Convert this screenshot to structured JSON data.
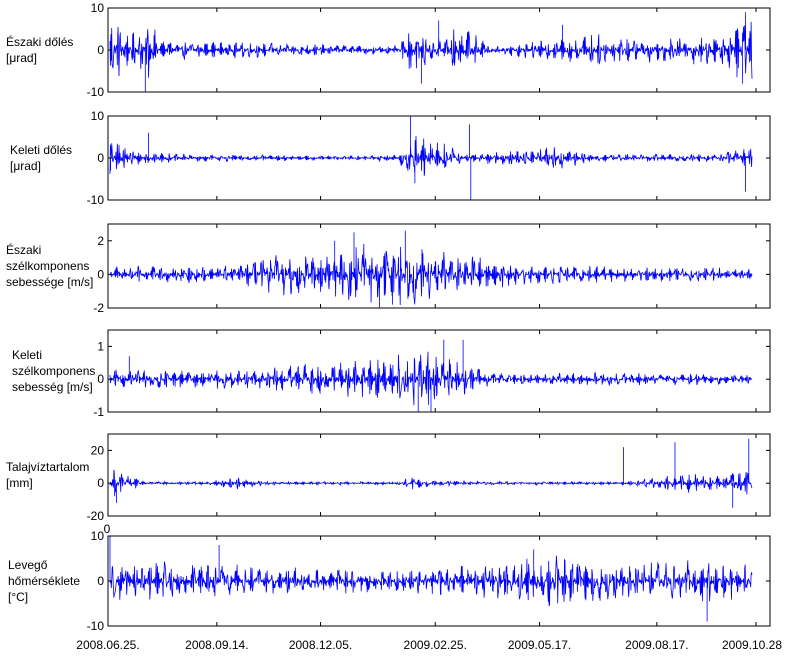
{
  "chart_data": {
    "type": "line",
    "x_tick_labels": [
      "2008.06.25.",
      "2008.09.14.",
      "2008.12.05.",
      "2009.02.25.",
      "2009.05.17.",
      "2009.08.17.",
      "2009.10.28"
    ],
    "panels": [
      {
        "ylabel": [
          "Északi dőlés",
          "[μrad]"
        ],
        "ylim": [
          -10,
          10
        ],
        "yticks": [
          -10,
          0,
          10
        ],
        "series": {
          "color": "#0000ff",
          "envelope": [
            [
              0,
              9
            ],
            [
              0.04,
              4
            ],
            [
              0.06,
              8
            ],
            [
              0.08,
              2.5
            ],
            [
              0.3,
              1.5
            ],
            [
              0.45,
              1
            ],
            [
              0.47,
              6
            ],
            [
              0.5,
              3
            ],
            [
              0.55,
              6
            ],
            [
              0.6,
              1
            ],
            [
              0.65,
              2
            ],
            [
              0.7,
              3
            ],
            [
              0.75,
              4
            ],
            [
              0.8,
              3
            ],
            [
              0.85,
              3
            ],
            [
              0.95,
              4
            ],
            [
              1,
              9
            ]
          ],
          "spikes": [
            [
              0.055,
              -10
            ],
            [
              0.485,
              -8
            ],
            [
              0.512,
              7
            ],
            [
              0.705,
              6
            ],
            [
              0.985,
              -8
            ],
            [
              0.99,
              9
            ]
          ]
        }
      },
      {
        "ylabel": [
          "Keleti dőlés",
          "[μrad]"
        ],
        "ylim": [
          -10,
          10
        ],
        "yticks": [
          -10,
          0,
          10
        ],
        "series": {
          "color": "#0000ff",
          "envelope": [
            [
              0,
              5
            ],
            [
              0.05,
              2
            ],
            [
              0.1,
              1
            ],
            [
              0.4,
              0.5
            ],
            [
              0.45,
              1
            ],
            [
              0.47,
              6
            ],
            [
              0.52,
              4
            ],
            [
              0.55,
              1
            ],
            [
              0.7,
              3
            ],
            [
              0.75,
              1
            ],
            [
              0.95,
              1
            ],
            [
              1,
              3
            ]
          ],
          "spikes": [
            [
              0.001,
              -3
            ],
            [
              0.06,
              6
            ],
            [
              0.468,
              10
            ],
            [
              0.475,
              -6
            ],
            [
              0.56,
              8
            ],
            [
              0.562,
              -10
            ],
            [
              0.99,
              -8
            ]
          ]
        }
      },
      {
        "ylabel": [
          "Északi",
          "szélkomponens",
          "sebessége [m/s]"
        ],
        "ylim": [
          -2,
          3
        ],
        "yticks": [
          -2,
          0,
          2
        ],
        "series": {
          "color": "#0000ff",
          "envelope": [
            [
              0,
              0.5
            ],
            [
              0.2,
              0.6
            ],
            [
              0.25,
              1.2
            ],
            [
              0.35,
              1.6
            ],
            [
              0.45,
              2.2
            ],
            [
              0.5,
              1.5
            ],
            [
              0.55,
              1.2
            ],
            [
              0.65,
              0.6
            ],
            [
              0.8,
              0.5
            ],
            [
              1,
              0.4
            ]
          ],
          "spikes": [
            [
              0.38,
              2.5
            ],
            [
              0.42,
              -2
            ],
            [
              0.46,
              2.6
            ],
            [
              0.44,
              -1.8
            ],
            [
              0.35,
              2
            ]
          ]
        }
      },
      {
        "ylabel": [
          "Keleti",
          "szélkomponens",
          "sebesség [m/s]"
        ],
        "ylim": [
          -1,
          1.5
        ],
        "yticks": [
          -1,
          0,
          1
        ],
        "series": {
          "color": "#0000ff",
          "envelope": [
            [
              0,
              0.3
            ],
            [
              0.2,
              0.3
            ],
            [
              0.3,
              0.5
            ],
            [
              0.4,
              0.6
            ],
            [
              0.45,
              0.8
            ],
            [
              0.5,
              0.9
            ],
            [
              0.55,
              0.5
            ],
            [
              0.6,
              0.2
            ],
            [
              0.8,
              0.2
            ],
            [
              1,
              0.15
            ]
          ],
          "spikes": [
            [
              0.52,
              1.2
            ],
            [
              0.5,
              -1
            ],
            [
              0.55,
              1.2
            ],
            [
              0.48,
              -1
            ],
            [
              0.03,
              0.7
            ]
          ]
        }
      },
      {
        "ylabel": [
          "Talajvíztartalom",
          "[mm]"
        ],
        "ylim": [
          -20,
          30
        ],
        "yticks": [
          -20,
          0,
          20
        ],
        "series": {
          "color": "#0000ff",
          "envelope": [
            [
              0,
              10
            ],
            [
              0.03,
              5
            ],
            [
              0.06,
              1
            ],
            [
              0.15,
              1
            ],
            [
              0.2,
              4
            ],
            [
              0.25,
              1
            ],
            [
              0.45,
              1
            ],
            [
              0.47,
              4
            ],
            [
              0.5,
              2
            ],
            [
              0.6,
              1
            ],
            [
              0.8,
              1
            ],
            [
              0.85,
              4
            ],
            [
              0.9,
              6
            ],
            [
              0.95,
              5
            ],
            [
              1,
              10
            ]
          ],
          "spikes": [
            [
              0.01,
              -12
            ],
            [
              0.8,
              22
            ],
            [
              0.88,
              25
            ],
            [
              0.995,
              27
            ],
            [
              0.97,
              -15
            ]
          ]
        }
      },
      {
        "ylabel": [
          "Levegő",
          "hőmérséklete",
          "[°C]"
        ],
        "ylim": [
          -10,
          10
        ],
        "yticks": [
          -10,
          0,
          10
        ],
        "extra_tick_label": "0",
        "series": {
          "color": "#0000ff",
          "envelope": [
            [
              0,
              5
            ],
            [
              0.15,
              4
            ],
            [
              0.3,
              3
            ],
            [
              0.45,
              2.5
            ],
            [
              0.55,
              4
            ],
            [
              0.6,
              5
            ],
            [
              0.7,
              6
            ],
            [
              0.8,
              4
            ],
            [
              0.9,
              5
            ],
            [
              1,
              4
            ]
          ],
          "spikes": [
            [
              0.0,
              10
            ],
            [
              0.93,
              -9
            ],
            [
              0.17,
              8
            ],
            [
              0.66,
              7
            ]
          ]
        }
      }
    ]
  }
}
